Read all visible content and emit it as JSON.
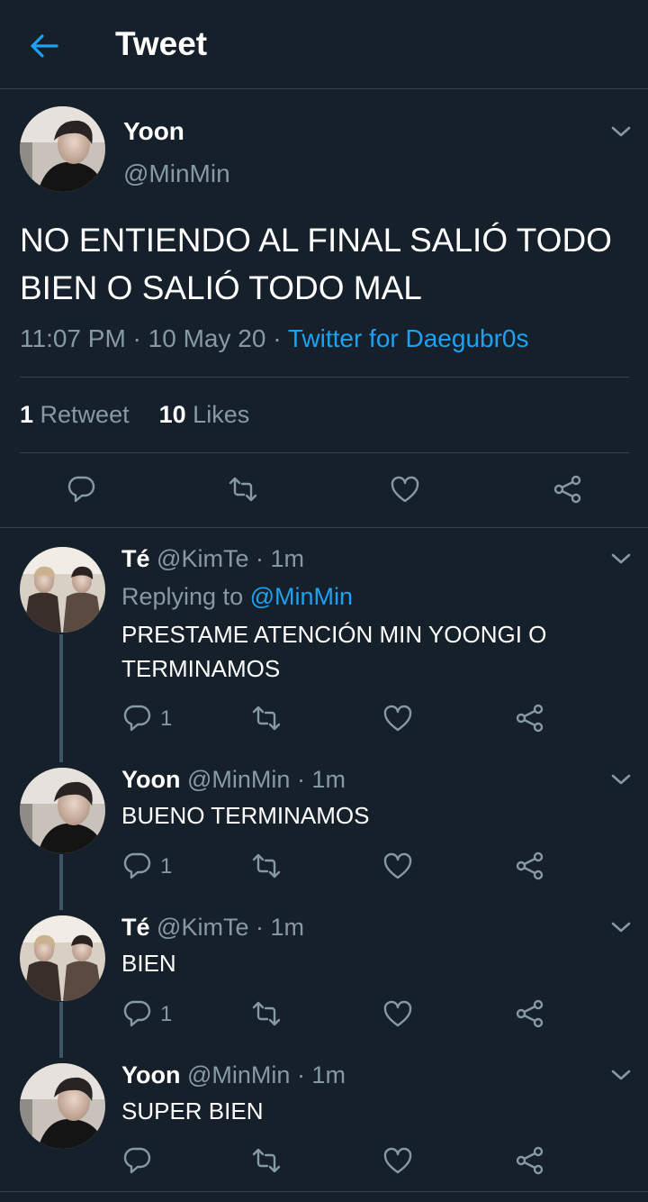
{
  "header": {
    "title": "Tweet",
    "back_icon": "back-arrow-icon",
    "accent": "#1da1f2"
  },
  "main_tweet": {
    "name": "Yoon",
    "handle": "@MinMin",
    "text": "NO ENTIENDO AL FINAL SALIÓ TODO BIEN O SALIÓ TODO MAL",
    "time": "11:07 PM",
    "date": "10 May 20",
    "separator": " · ",
    "source": "Twitter for Daegubr0s",
    "retweet_count": "1",
    "retweet_label": " Retweet",
    "like_count": "10",
    "like_label": " Likes"
  },
  "replies": [
    {
      "name": "Té",
      "handle": "@KimTe",
      "time": "· 1m",
      "replying_prefix": "Replying to ",
      "replying_to": "@MinMin",
      "text": "PRESTAME ATENCIÓN MIN YOONGI O TERMINAMOS",
      "reply_count": "1"
    },
    {
      "name": "Yoon",
      "handle": "@MinMin",
      "time": "· 1m",
      "text": "BUENO TERMINAMOS",
      "reply_count": "1"
    },
    {
      "name": "Té",
      "handle": "@KimTe",
      "time": "· 1m",
      "text": "BIEN",
      "reply_count": "1"
    },
    {
      "name": "Yoon",
      "handle": "@MinMin",
      "time": "· 1m",
      "text": "SUPER BIEN",
      "reply_count": ""
    }
  ],
  "colors": {
    "background": "#15202b",
    "muted": "#8899a6",
    "divider": "#38444d",
    "thread_line": "#3d5466"
  }
}
